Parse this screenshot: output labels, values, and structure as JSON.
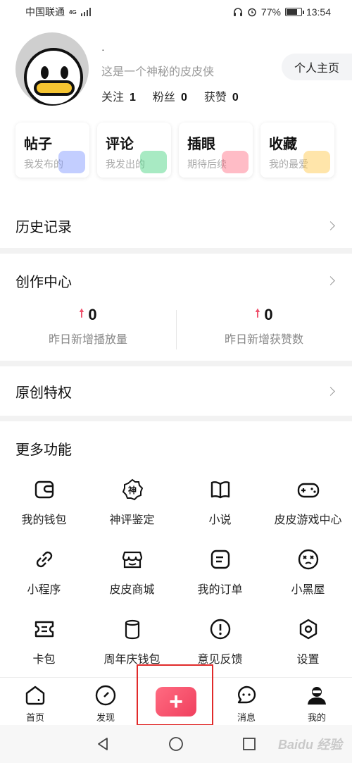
{
  "status_bar": {
    "carrier": "中国联通",
    "network": "4G",
    "battery": "77%",
    "battery_level": 0.77,
    "time": "13:54"
  },
  "profile": {
    "nickname": "·",
    "bio": "这是一个神秘的皮皮侠",
    "stats": [
      {
        "label": "关注",
        "value": "1"
      },
      {
        "label": "粉丝",
        "value": "0"
      },
      {
        "label": "获赞",
        "value": "0"
      }
    ],
    "homepage_button": "个人主页"
  },
  "quick_cards": [
    {
      "title": "帖子",
      "subtitle": "我发布的",
      "color": "#7a93ff"
    },
    {
      "title": "评论",
      "subtitle": "我发出的",
      "color": "#3fd17a"
    },
    {
      "title": "插眼",
      "subtitle": "期待后续",
      "color": "#ff6b81"
    },
    {
      "title": "收藏",
      "subtitle": "我的最爱",
      "color": "#ffc542"
    }
  ],
  "history": {
    "label": "历史记录"
  },
  "creator_center": {
    "label": "创作中心",
    "stats": [
      {
        "value": "0",
        "label": "昨日新增播放量"
      },
      {
        "value": "0",
        "label": "昨日新增获赞数"
      }
    ]
  },
  "original_privilege": {
    "label": "原创特权"
  },
  "more_features": {
    "title": "更多功能",
    "items": [
      {
        "label": "我的钱包",
        "icon": "wallet-icon"
      },
      {
        "label": "神评鉴定",
        "icon": "comment-badge-icon"
      },
      {
        "label": "小说",
        "icon": "book-icon"
      },
      {
        "label": "皮皮游戏中心",
        "icon": "gamepad-icon"
      },
      {
        "label": "小程序",
        "icon": "link-icon"
      },
      {
        "label": "皮皮商城",
        "icon": "store-icon"
      },
      {
        "label": "我的订单",
        "icon": "order-icon"
      },
      {
        "label": "小黑屋",
        "icon": "dead-face-icon"
      },
      {
        "label": "卡包",
        "icon": "ticket-icon"
      },
      {
        "label": "周年庆钱包",
        "icon": "jar-icon"
      },
      {
        "label": "意见反馈",
        "icon": "feedback-icon"
      },
      {
        "label": "设置",
        "icon": "settings-icon"
      }
    ]
  },
  "tabbar": {
    "tabs": [
      {
        "label": "首页",
        "icon": "home-icon"
      },
      {
        "label": "发现",
        "icon": "compass-icon"
      },
      {
        "label": "",
        "icon": "plus-icon"
      },
      {
        "label": "消息",
        "icon": "message-icon"
      },
      {
        "label": "我的",
        "icon": "profile-icon"
      }
    ],
    "publish_symbol": "+",
    "highlight_color": "#e12a2a"
  },
  "system_nav": {
    "icons": [
      "back-icon",
      "home-circle-icon",
      "recents-icon"
    ]
  },
  "watermark": "Baidu 经验"
}
